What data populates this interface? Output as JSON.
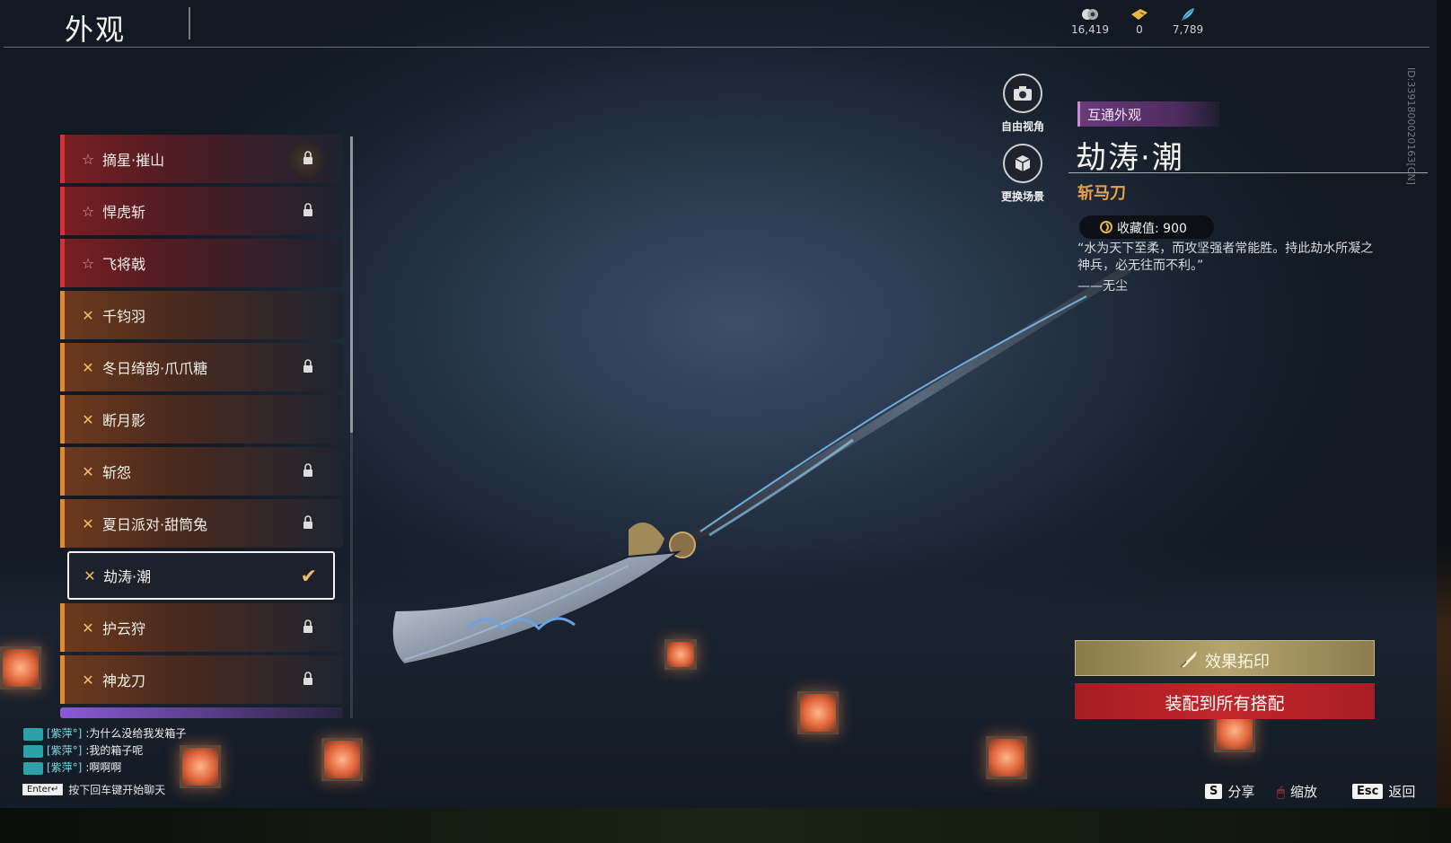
{
  "header": {
    "title": "外观",
    "currencies": [
      {
        "icon": "jade-coin-icon",
        "value": "16,419"
      },
      {
        "icon": "ticket-icon",
        "value": "0"
      },
      {
        "icon": "feather-token-icon",
        "value": "7,789"
      }
    ]
  },
  "list": {
    "items": [
      {
        "label": "摘星·摧山",
        "rarity": "red",
        "locked": true
      },
      {
        "label": "悍虎斩",
        "rarity": "red",
        "locked": true
      },
      {
        "label": "飞将戟",
        "rarity": "red",
        "locked": false
      },
      {
        "label": "千钧羽",
        "rarity": "gold",
        "locked": false
      },
      {
        "label": "冬日绮韵·爪爪糖",
        "rarity": "gold",
        "locked": true
      },
      {
        "label": "断月影",
        "rarity": "gold",
        "locked": false
      },
      {
        "label": "斩怨",
        "rarity": "gold",
        "locked": true
      },
      {
        "label": "夏日派对·甜筒兔",
        "rarity": "gold",
        "locked": true
      },
      {
        "label": "劫涛·潮",
        "rarity": "gold",
        "locked": false,
        "selected": true
      },
      {
        "label": "护云狩",
        "rarity": "gold",
        "locked": true
      },
      {
        "label": "神龙刀",
        "rarity": "gold",
        "locked": true
      }
    ]
  },
  "camera": {
    "free_view": "自由视角",
    "change_scene": "更换场景"
  },
  "detail": {
    "tag": "互通外观",
    "name": "劫涛·潮",
    "type": "斩马刀",
    "collect_label": "收藏值: 900",
    "quote": "“水为天下至柔，而攻坚强者常能胜。持此劫水所凝之神兵，必无往而不利。”",
    "author": "——无尘",
    "side_id": "ID:3391800020163[CN]"
  },
  "actions": {
    "effect": "效果拓印",
    "equip": "装配到所有搭配"
  },
  "hotkeys": [
    {
      "key": "S",
      "label": "分享"
    },
    {
      "key": "🖱",
      "label": "缩放"
    },
    {
      "key": "Esc",
      "label": "返回"
    }
  ],
  "chat": {
    "lines": [
      {
        "user": "[紫萍°]",
        "text": ":为什么没给我发箱子"
      },
      {
        "user": "[紫萍°]",
        "text": ":我的箱子呢"
      },
      {
        "user": "[紫萍°]",
        "text": ":啊啊啊"
      }
    ],
    "enter_key": "Enter↵",
    "hint": "按下回车键开始聊天"
  },
  "colors": {
    "red_rarity": "#d23238",
    "gold_rarity": "#e08a2a",
    "equip_button": "#c2262b",
    "type_text": "#e6a24a"
  }
}
